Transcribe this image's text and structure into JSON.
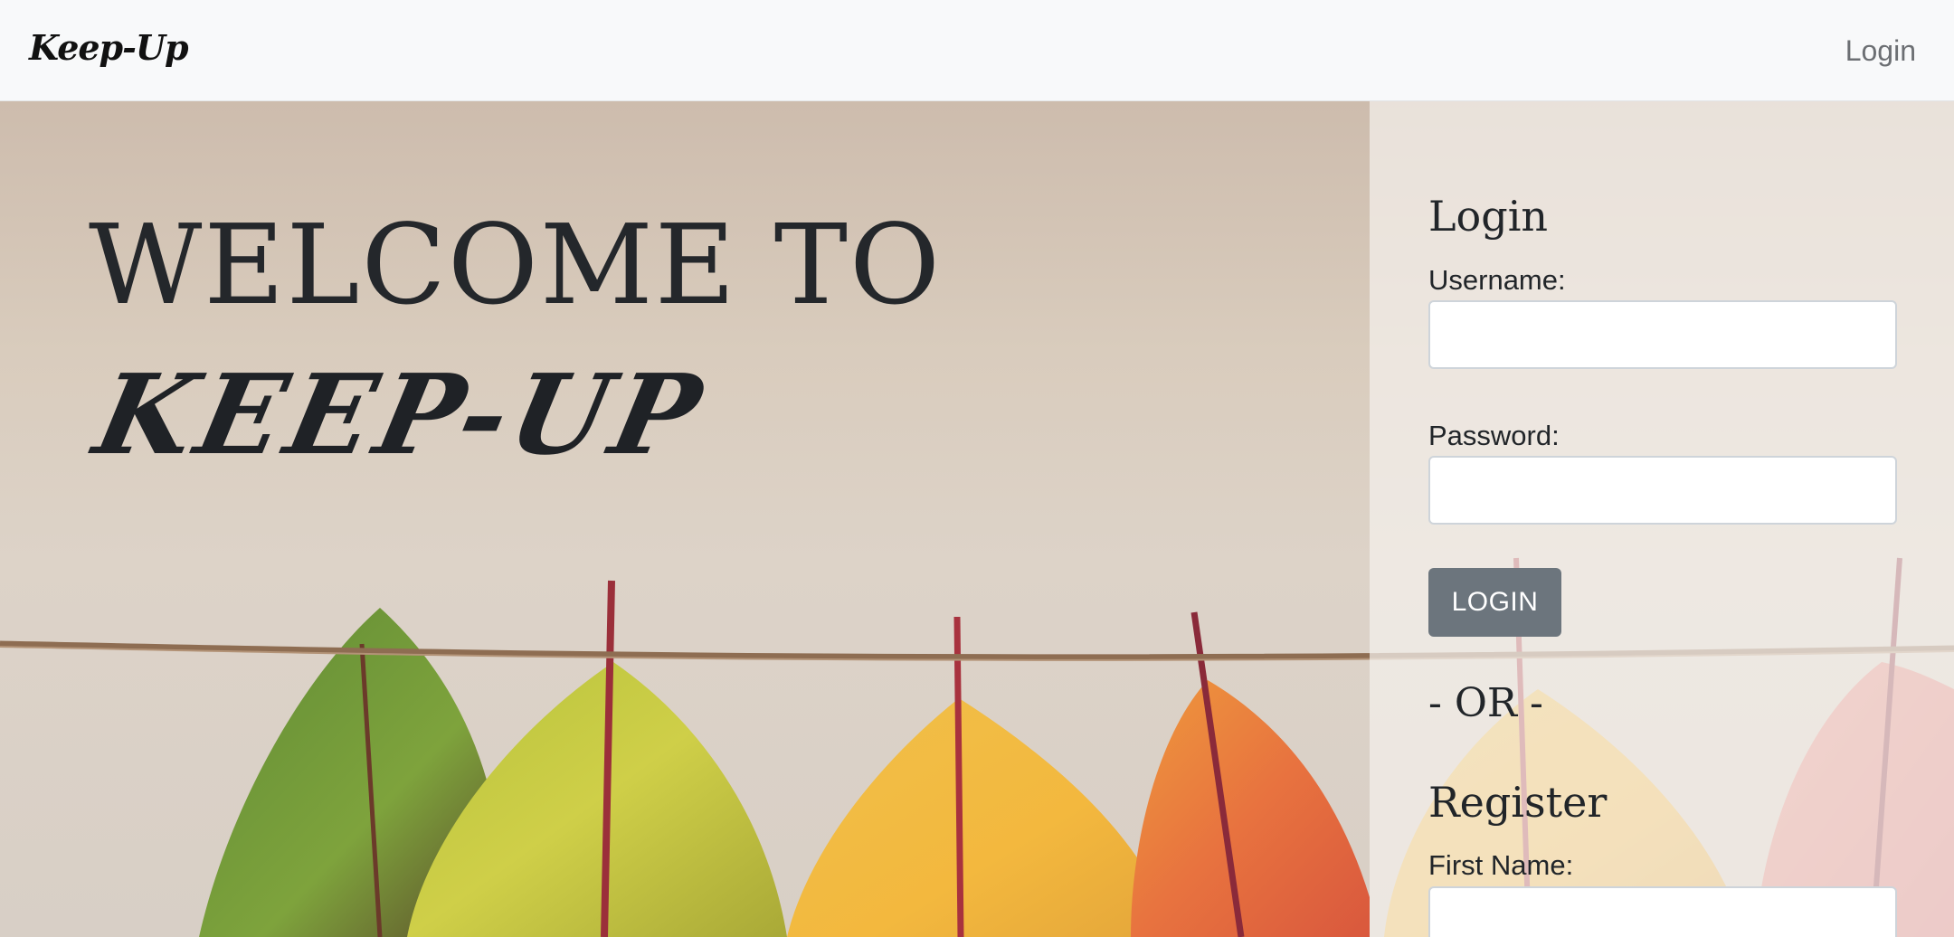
{
  "navbar": {
    "brand": "Keep-Up",
    "login_link": "Login"
  },
  "hero": {
    "welcome_line1": "WELCOME TO",
    "welcome_line2": "KEEP-UP"
  },
  "login_form": {
    "title": "Login",
    "username_label": "Username:",
    "username_value": "",
    "password_label": "Password:",
    "password_value": "",
    "submit_label": "LOGIN"
  },
  "divider": {
    "text": "- OR -"
  },
  "register_form": {
    "title": "Register",
    "first_name_label": "First Name:",
    "first_name_value": ""
  },
  "colors": {
    "navbar_bg": "#f8f9fa",
    "button_bg": "#6c757d",
    "text": "#212529",
    "nav_link": "#6c6f73"
  }
}
